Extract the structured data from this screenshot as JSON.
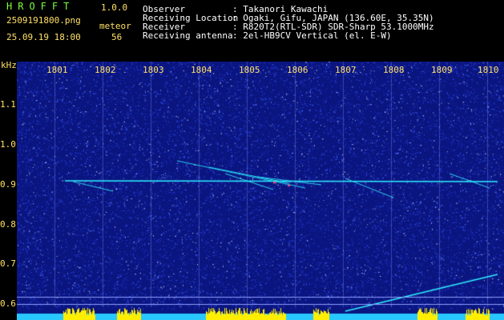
{
  "header": {
    "app_name": "HROFFT",
    "app_version": "1.0.0",
    "file_name": "2509191800.png",
    "date_time": "25.09.19 18:00",
    "meteor_label": "meteor",
    "meteor_count": "56",
    "info": [
      {
        "label": "Observer",
        "value": ": Takanori Kawachi"
      },
      {
        "label": "Receiving Location",
        "value": ": Ogaki, Gifu, JAPAN (136.60E, 35.35N)"
      },
      {
        "label": "Receiver",
        "value": ": R820T2(RTL-SDR) SDR-Sharp 53.1000MHz"
      },
      {
        "label": "Receiving antenna",
        "value": ": 2el-HB9CV Vertical (el. E-W)"
      }
    ]
  },
  "spectrogram": {
    "y_unit": "kHz",
    "x_ticks": [
      "1801",
      "1802",
      "1803",
      "1804",
      "1805",
      "1806",
      "1807",
      "1808",
      "1809",
      "1810"
    ],
    "y_ticks": [
      "1.1",
      "1.0",
      "0.9",
      "0.8",
      "0.7",
      "0.6"
    ],
    "colors": {
      "background": "#0a1580",
      "noise": "#3a5fff",
      "signal": "#2ef0ff",
      "audio": "#ffee00",
      "baseline": "#28c8ff",
      "grid": "#8f9fff"
    }
  }
}
